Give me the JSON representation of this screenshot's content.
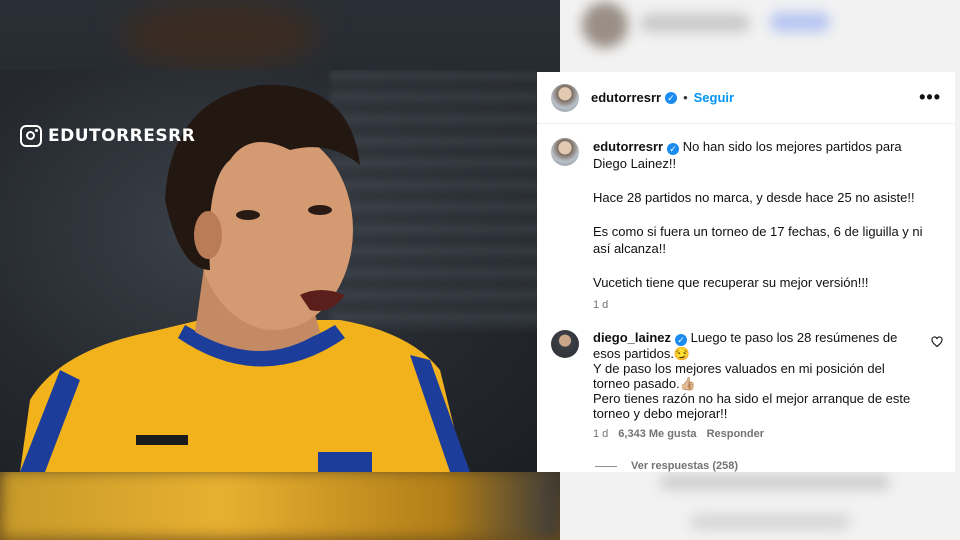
{
  "watermark": {
    "icon": "instagram-icon",
    "handle": "EDUTORRESRR"
  },
  "header": {
    "username": "edutorresrr",
    "separator": "•",
    "follow_label": "Seguir",
    "more_label": "•••"
  },
  "caption": {
    "username": "edutorresrr",
    "paragraphs": [
      "No han sido los mejores partidos para Diego Lainez!!",
      "Hace 28 partidos no marca, y desde hace 25 no asiste!!",
      "Es como si fuera un torneo de 17 fechas, 6 de liguilla y ni así alcanza!!",
      "Vucetich tiene que recuperar su mejor versión!!!"
    ],
    "time": "1 d"
  },
  "comment": {
    "username": "diego_lainez",
    "lines": [
      "Luego te paso los 28 resúmenes de esos partidos.😏",
      "Y de paso los mejores valuados en mi posición del torneo pasado.👍🏼",
      "Pero tienes razón no ha sido el mejor arranque de este torneo y debo mejorar!!"
    ],
    "time": "1 d",
    "likes": "6,343 Me gusta",
    "reply_label": "Responder",
    "view_replies": "Ver respuestas (258)"
  },
  "colors": {
    "accent": "#0095f6",
    "verified": "#1a8cf0",
    "meta": "#737373"
  }
}
